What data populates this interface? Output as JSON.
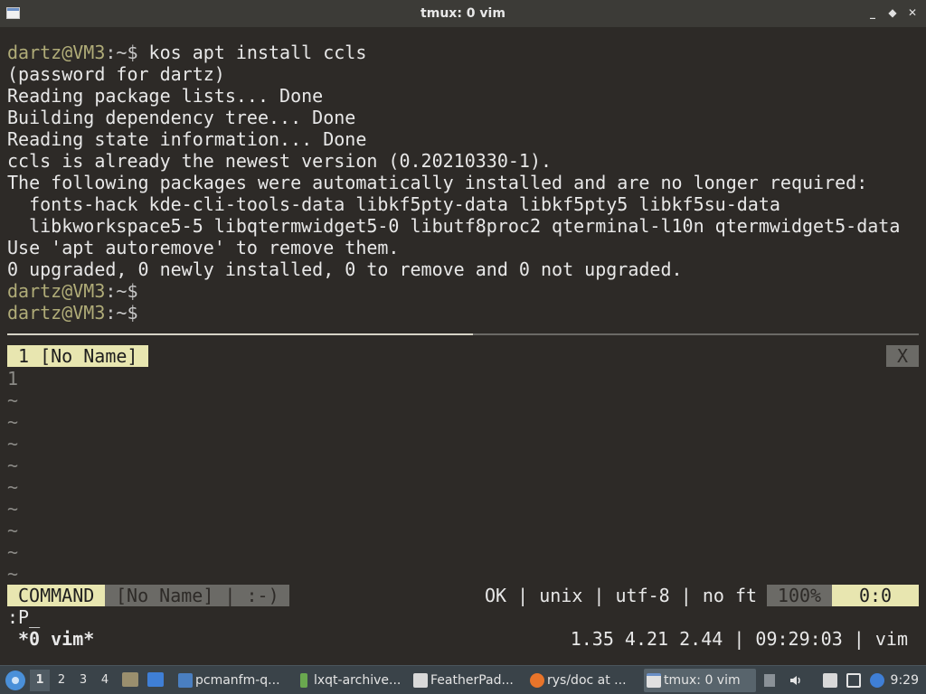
{
  "window": {
    "title": "tmux: 0 vim",
    "controls": [
      "_",
      "◆",
      "✕"
    ]
  },
  "terminal": {
    "prompt_user": "dartz@VM3",
    "prompt_suffix": ":~$",
    "command": " kos apt install ccls",
    "output": [
      "(password for dartz)",
      "Reading package lists... Done",
      "Building dependency tree... Done",
      "Reading state information... Done",
      "ccls is already the newest version (0.20210330-1).",
      "The following packages were automatically installed and are no longer required:",
      "  fonts-hack kde-cli-tools-data libkf5pty-data libkf5pty5 libkf5su-data",
      "  libkworkspace5-5 libqtermwidget5-0 libutf8proc2 qterminal-l10n qtermwidget5-data",
      "Use 'apt autoremove' to remove them.",
      "0 upgraded, 0 newly installed, 0 to remove and 0 not upgraded."
    ]
  },
  "vim": {
    "tab_label": "1 [No Name]",
    "tab_close": "X",
    "line_number": "1",
    "tilde": "~",
    "mode": "COMMAND",
    "file_segment": "[No Name] | :-)",
    "info": "OK | unix | utf-8 | no ft",
    "percent": "100%",
    "position": "0:0",
    "cmdline": ":P_"
  },
  "tmux": {
    "window": "*0 vim*",
    "status_right": "1.35 4.21 2.44 | 09:29:03 | vim"
  },
  "taskbar": {
    "desktops": [
      "1",
      "2",
      "3",
      "4"
    ],
    "tasks": [
      {
        "label": "pcmanfm-q...",
        "color": "#4a7fc1"
      },
      {
        "label": "lxqt-archive...",
        "color": "#6aa84f"
      },
      {
        "label": "FeatherPad...",
        "color": "#d9d9d9"
      },
      {
        "label": "rys/doc at ...",
        "color": "#e8742a"
      },
      {
        "label": "tmux: 0 vim",
        "color": "#e0e0e0"
      }
    ],
    "clock": "9:29"
  }
}
